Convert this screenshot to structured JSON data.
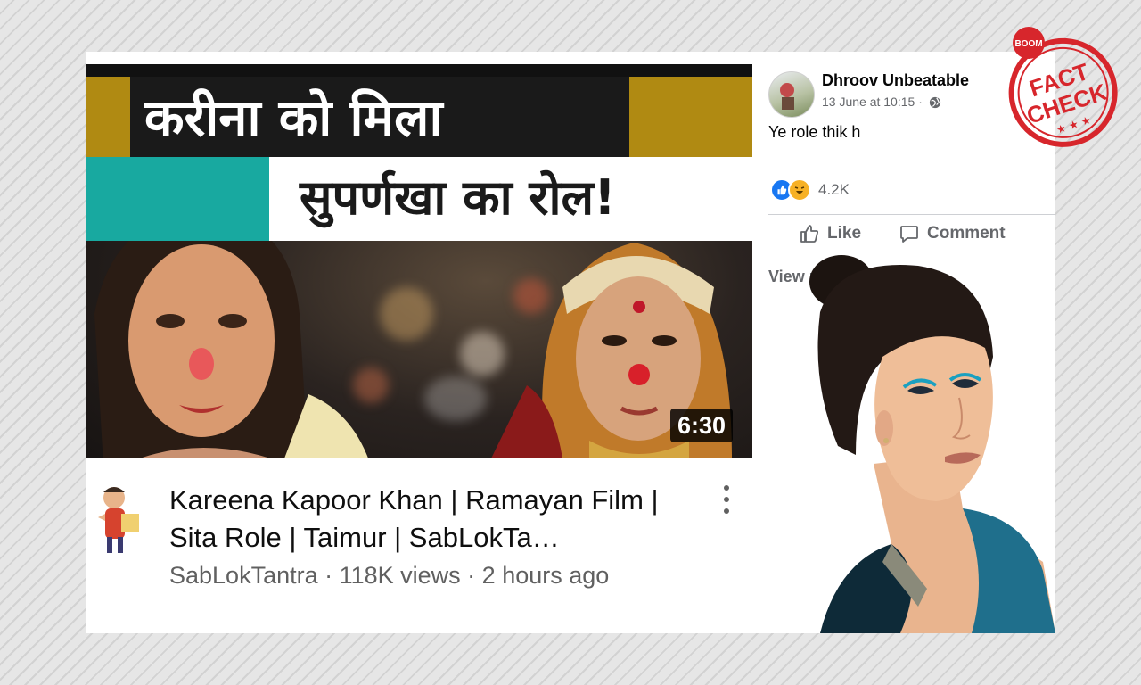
{
  "video": {
    "thumbnail_line1": "करीना को मिला",
    "thumbnail_line2": "सुपर्णखा का रोल!",
    "duration": "6:30",
    "title": "Kareena Kapoor Khan | Ramayan Film | Sita Role | Taimur | SabLokTa…",
    "meta": "SabLokTantra · 118K views · 2 hours ago",
    "more_icon": "kebab-menu-icon"
  },
  "post": {
    "author": "Dhroov Unbeatable",
    "timestamp": "13 June at 10:15 ·",
    "privacy_icon": "globe-icon",
    "text": "Ye role thik h",
    "reaction_count": "4.2K",
    "like_label": "Like",
    "comment_label": "Comment",
    "view_more": "View p"
  },
  "stamp": {
    "brand": "BOOM",
    "line1": "FACT",
    "line2": "CHECK"
  },
  "colors": {
    "fb_blue": "#1877f2",
    "stamp_red": "#d7262c",
    "banner_teal": "#18a9a0",
    "banner_gold": "#b08a12"
  }
}
